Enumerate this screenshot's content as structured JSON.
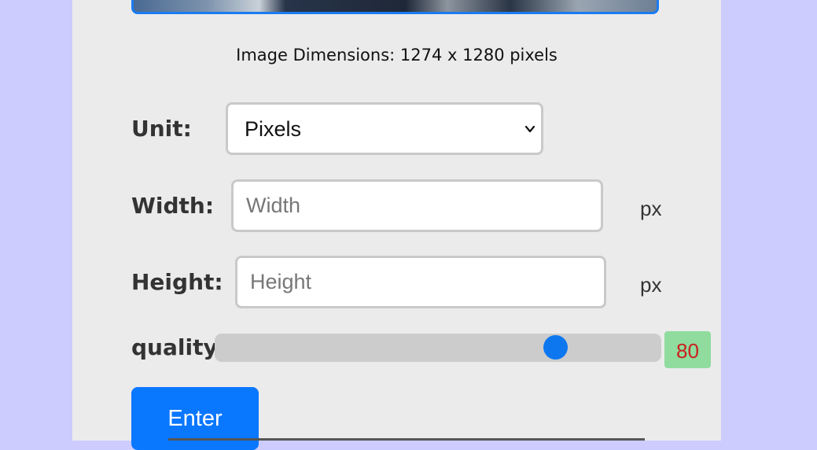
{
  "image": {
    "dimensions_text": "Image Dimensions: 1274 x 1280 pixels"
  },
  "unit": {
    "label": "Unit:",
    "selected": "Pixels"
  },
  "width": {
    "label": "Width:",
    "placeholder": "Width",
    "value": "",
    "unit": "px"
  },
  "height": {
    "label": "Height:",
    "placeholder": "Height",
    "value": "",
    "unit": "px"
  },
  "quality": {
    "label": "quality:",
    "value": 80,
    "value_text": "80"
  },
  "actions": {
    "enter_label": "Enter"
  },
  "colors": {
    "page_background": "#ccccff",
    "panel_background": "#ebebeb",
    "accent": "#0a77ff",
    "badge_background": "#8fdc9e",
    "badge_text": "#cc1f1f"
  },
  "icons": {
    "select_arrow": "chevron-down-icon"
  }
}
